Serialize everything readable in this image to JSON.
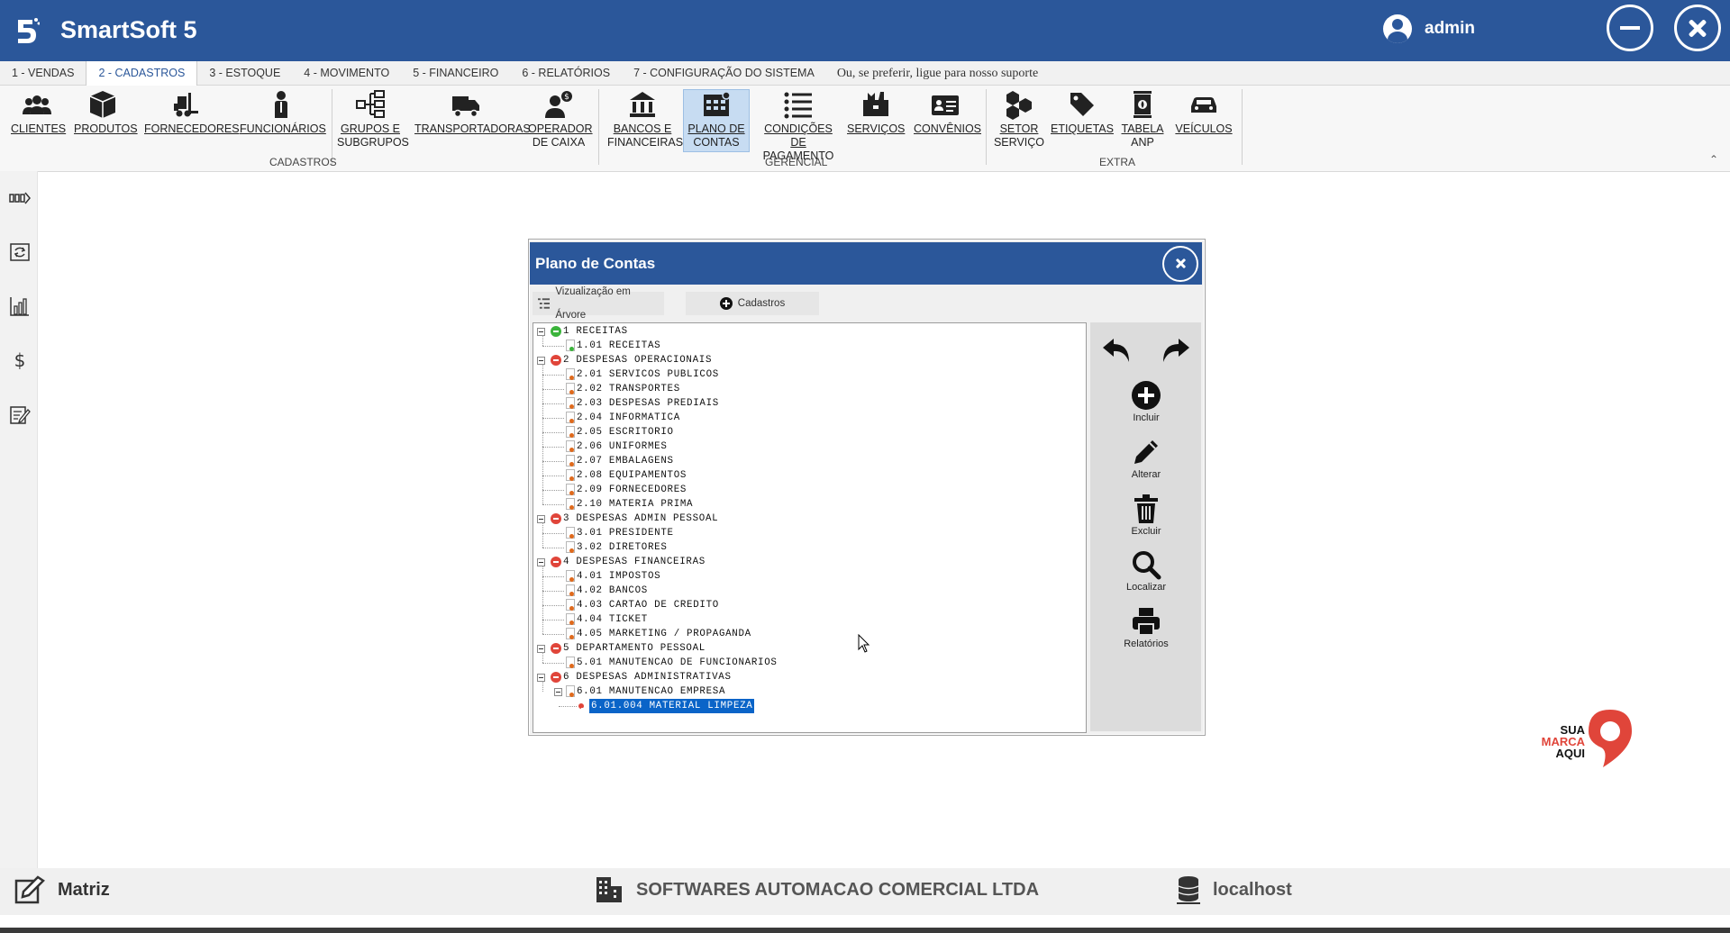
{
  "app": {
    "title": "SmartSoft 5",
    "user": "admin"
  },
  "tabs": [
    {
      "label": "1 - VENDAS"
    },
    {
      "label": "2 - CADASTROS",
      "active": true
    },
    {
      "label": "3 - ESTOQUE"
    },
    {
      "label": "4 - MOVIMENTO"
    },
    {
      "label": "5 - FINANCEIRO"
    },
    {
      "label": "6 - RELATÓRIOS"
    },
    {
      "label": "7 - CONFIGURAÇÃO DO SISTEMA"
    }
  ],
  "tabs_note": "Ou, se preferir, ligue para nosso suporte",
  "ribbon": {
    "groups": [
      "CADASTROS",
      "GERENCIAL",
      "EXTRA"
    ],
    "buttons": {
      "clientes": "CLIENTES",
      "produtos": "PRODUTOS",
      "fornecedores": "FORNECEDORES",
      "funcionarios": "FUNCIONÁRIOS",
      "grupos_1": "GRUPOS E",
      "grupos_2": "SUBGRUPOS",
      "transportadoras": "TRANSPORTADORAS",
      "operador_1": "OPERADOR",
      "operador_2": "DE CAIXA",
      "bancos_1": "BANCOS E",
      "bancos_2": "FINANCEIRAS",
      "plano_1": "PLANO DE",
      "plano_2": "CONTAS",
      "condicoes_1": "CONDIÇÕES DE",
      "condicoes_2": "PAGAMENTO",
      "servicos": "SERVIÇOS",
      "convenios": "CONVÊNIOS",
      "setor_1": "SETOR",
      "setor_2": "SERVIÇO",
      "etiquetas": "ETIQUETAS",
      "tabela_1": "TABELA",
      "tabela_2": "ANP",
      "veiculos": "VEÍCULOS"
    }
  },
  "dialog": {
    "title": "Plano de Contas",
    "tab_tree": "Vizualização em Árvore",
    "tab_cad": "Cadastros",
    "tree": [
      {
        "text": "1 RECEITAS",
        "level": 0,
        "type": "group",
        "color": "green"
      },
      {
        "text": "1.01 RECEITAS",
        "level": 1,
        "type": "leaf",
        "color": "green"
      },
      {
        "text": "2 DESPESAS OPERACIONAIS",
        "level": 0,
        "type": "group",
        "color": "red"
      },
      {
        "text": "2.01 SERVICOS PUBLICOS",
        "level": 1,
        "type": "leaf"
      },
      {
        "text": "2.02 TRANSPORTES",
        "level": 1,
        "type": "leaf"
      },
      {
        "text": "2.03 DESPESAS PREDIAIS",
        "level": 1,
        "type": "leaf"
      },
      {
        "text": "2.04 INFORMATICA",
        "level": 1,
        "type": "leaf"
      },
      {
        "text": "2.05 ESCRITORIO",
        "level": 1,
        "type": "leaf"
      },
      {
        "text": "2.06 UNIFORMES",
        "level": 1,
        "type": "leaf"
      },
      {
        "text": "2.07 EMBALAGENS",
        "level": 1,
        "type": "leaf"
      },
      {
        "text": "2.08 EQUIPAMENTOS",
        "level": 1,
        "type": "leaf"
      },
      {
        "text": "2.09 FORNECEDORES",
        "level": 1,
        "type": "leaf"
      },
      {
        "text": "2.10 MATERIA PRIMA",
        "level": 1,
        "type": "leaf"
      },
      {
        "text": "3 DESPESAS ADMIN PESSOAL",
        "level": 0,
        "type": "group",
        "color": "red"
      },
      {
        "text": "3.01 PRESIDENTE",
        "level": 1,
        "type": "leaf"
      },
      {
        "text": "3.02 DIRETORES",
        "level": 1,
        "type": "leaf"
      },
      {
        "text": "4 DESPESAS FINANCEIRAS",
        "level": 0,
        "type": "group",
        "color": "red"
      },
      {
        "text": "4.01 IMPOSTOS",
        "level": 1,
        "type": "leaf"
      },
      {
        "text": "4.02 BANCOS",
        "level": 1,
        "type": "leaf"
      },
      {
        "text": "4.03 CARTAO DE CREDITO",
        "level": 1,
        "type": "leaf"
      },
      {
        "text": "4.04 TICKET",
        "level": 1,
        "type": "leaf"
      },
      {
        "text": "4.05 MARKETING / PROPAGANDA",
        "level": 1,
        "type": "leaf"
      },
      {
        "text": "5 DEPARTAMENTO PESSOAL",
        "level": 0,
        "type": "group",
        "color": "red"
      },
      {
        "text": "5.01 MANUTENCAO DE FUNCIONARIOS",
        "level": 1,
        "type": "leaf"
      },
      {
        "text": "6 DESPESAS ADMINISTRATIVAS",
        "level": 0,
        "type": "group",
        "color": "red"
      },
      {
        "text": "6.01 MANUTENCAO EMPRESA",
        "level": 1,
        "type": "subgroup"
      },
      {
        "text": "6.01.004 MATERIAL LIMPEZA",
        "level": 2,
        "type": "leaf",
        "selected": true
      }
    ],
    "actions": {
      "incluir": "Incluir",
      "alterar": "Alterar",
      "excluir": "Excluir",
      "localizar": "Localizar",
      "relatorios": "Relatórios"
    }
  },
  "brand": {
    "line1": "SUA",
    "line2": "MARCA",
    "line3": "AQUI"
  },
  "status": {
    "branch": "Matriz",
    "company": "SOFTWARES AUTOMACAO COMERCIAL LTDA",
    "server": "localhost"
  },
  "colors": {
    "primary": "#2b579a",
    "selection": "#0a64c8",
    "red_node": "#e0453a",
    "green_node": "#3bb43b"
  }
}
